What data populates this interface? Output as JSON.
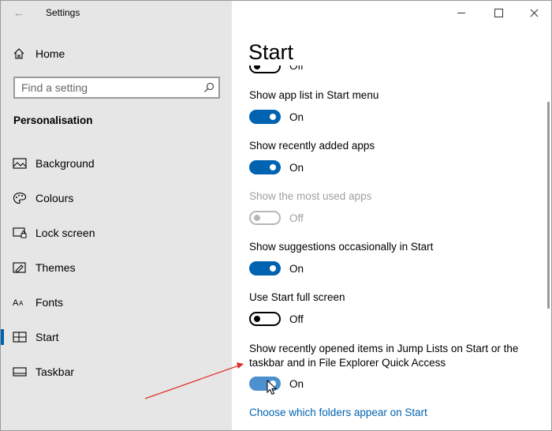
{
  "window": {
    "title": "Settings"
  },
  "sidebar": {
    "home_label": "Home",
    "search_placeholder": "Find a setting",
    "section_title": "Personalisation",
    "items": [
      {
        "label": "Background",
        "icon": "picture-icon"
      },
      {
        "label": "Colours",
        "icon": "palette-icon"
      },
      {
        "label": "Lock screen",
        "icon": "lock-screen-icon"
      },
      {
        "label": "Themes",
        "icon": "themes-icon"
      },
      {
        "label": "Fonts",
        "icon": "fonts-icon"
      },
      {
        "label": "Start",
        "icon": "start-icon",
        "selected": true
      },
      {
        "label": "Taskbar",
        "icon": "taskbar-icon"
      }
    ]
  },
  "main": {
    "title": "Start",
    "partial_top_state": "Off",
    "settings": [
      {
        "label": "Show app list in Start menu",
        "state": "On",
        "enabled": true
      },
      {
        "label": "Show recently added apps",
        "state": "On",
        "enabled": true
      },
      {
        "label": "Show the most used apps",
        "state": "Off",
        "enabled": false
      },
      {
        "label": "Show suggestions occasionally in Start",
        "state": "On",
        "enabled": true
      },
      {
        "label": "Use Start full screen",
        "state": "Off",
        "enabled": true
      },
      {
        "label": "Show recently opened items in Jump Lists on Start or the taskbar and in File Explorer Quick Access",
        "state": "On",
        "enabled": true
      }
    ],
    "link": "Choose which folders appear on Start"
  },
  "colors": {
    "accent": "#0063b1",
    "toggle_hover": "#4d90cf",
    "sidebar_bg": "#e6e6e6",
    "annotation_arrow": "#e0302a"
  }
}
